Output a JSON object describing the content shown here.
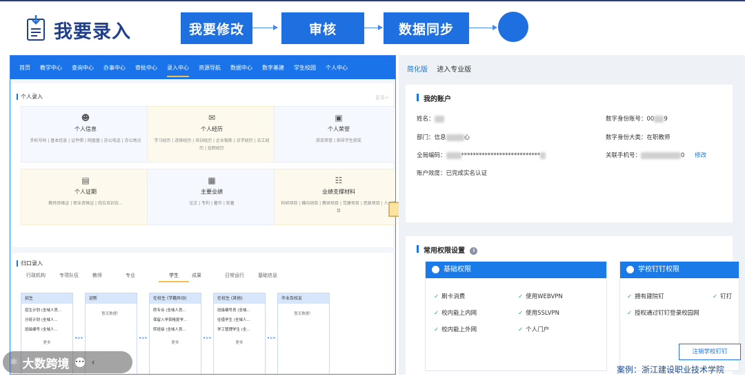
{
  "header": {
    "title": "我要录入",
    "steps": [
      "我要修改",
      "审核",
      "数据同步"
    ]
  },
  "left": {
    "nav": [
      "首页",
      "教学中心",
      "查询中心",
      "办事中心",
      "审批中心",
      "录入中心",
      "资源导航",
      "数据中心",
      "数字基建",
      "学生校园",
      "个人中心"
    ],
    "active_nav": "录入中心",
    "personal_section": "个人录入",
    "more": "更多>",
    "cards": [
      {
        "name": "个人信息",
        "icon": "person-icon",
        "sub": "手机号码 | 基本信息 | 证件照 | 网盘盘 | 办公电话 | 办公地点"
      },
      {
        "name": "个人经历",
        "icon": "mail-icon",
        "sub": "学习经历 | 进修经历 | 培训经历 | 企业锻炼 | 访学经历 | 访工经历 | 挂职经历"
      },
      {
        "name": "个人荣誉",
        "icon": "badge-icon",
        "sub": "获奖荣誉 | 指导学生获奖"
      },
      {
        "name": "个人证期",
        "icon": "certificate-icon",
        "sub": "教师资格证 | 职业资格证 | 岗位培训合..."
      },
      {
        "name": "主要业绩",
        "icon": "chart-icon",
        "sub": "论文 | 专利 | 著作 | 软著"
      },
      {
        "name": "业绩支撑材料",
        "icon": "document-icon",
        "sub": "科研项目 | 横向项目 | 教研项目 | 党建项目 | 思政项目 | 人才项目"
      }
    ],
    "dept_section": "归口录入",
    "tabs": [
      "行政机构",
      "专项队伍",
      "教师",
      "专业",
      "学生",
      "成果",
      "日常运行",
      "基础信息"
    ],
    "active_tab": "学生",
    "flows": [
      {
        "title": "招生",
        "items": [
          "招生计划 (全域人员...",
          "分班计划 (全域人...",
          "班级编号 (全域人..."
        ],
        "more": "更多"
      },
      {
        "title": "迎新",
        "empty": "暂无数据！"
      },
      {
        "title": "在校生 (学籍异动)",
        "items": [
          "转专业 (全域人员...",
          "保留入学资格复学...",
          "转班级 (全域人员..."
        ],
        "more": "更多"
      },
      {
        "title": "在校生 (其他)",
        "items": [
          "班级编号员 (全域...",
          "往借学生 (全域人...",
          "学工管理学生 (全..."
        ],
        "more": "更多"
      },
      {
        "title": "毕业及校友",
        "empty": "暂无数据！"
      }
    ]
  },
  "right": {
    "tabs": [
      "简化版",
      "进入专业版"
    ],
    "account_title": "我的账户",
    "fields": {
      "name_label": "姓名：",
      "dept_label": "部门：",
      "dept_value_start": "信息",
      "dept_value_end": "心",
      "code_label": "全局编码：",
      "code_value": "***************************",
      "validity_label": "账户效度：",
      "validity_value": "已完成实名认证",
      "digital_id_label": "数字身份账号：",
      "digital_id_value_start": "00",
      "digital_id_value_end": "9",
      "digital_class_label": "数字身份大类：",
      "digital_class_value": "在职教师",
      "phone_label": "关联手机号：",
      "phone_value_end": "0",
      "modify": "修改"
    },
    "perm_title": "常用权限设置",
    "basic": {
      "title": "基础权限",
      "items": [
        "刷卡消费",
        "使用WEBVPN",
        "校内能上内网",
        "使用SSLVPN",
        "校内能上外网",
        "个人门户"
      ]
    },
    "dingtalk": {
      "title": "学校钉钉权限",
      "items": [
        "拥有建院钉",
        "钉打",
        "授权通过钉钉登录校园网"
      ]
    },
    "logout": "注销学校钉钉"
  },
  "watermark": "大数跨境",
  "caption": "案例：浙江建设职业技术学院"
}
